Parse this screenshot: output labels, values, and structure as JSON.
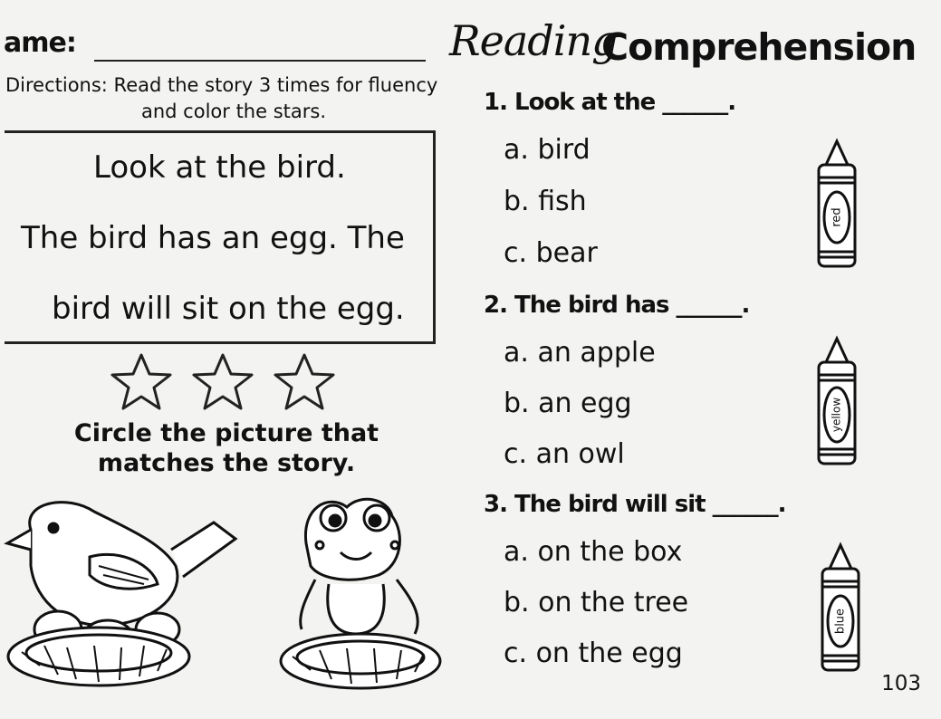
{
  "header": {
    "name_label": "ame:",
    "title_script": "Reading",
    "title_bold": "Comprehension"
  },
  "directions": {
    "line1": "Directions: Read the story 3 times for fluency",
    "line2": "and color the stars."
  },
  "story": {
    "lines": [
      "Look at the bird.",
      "The bird has an egg. The",
      "bird will sit on the egg."
    ]
  },
  "activity": {
    "instruction_line1": "Circle the picture that",
    "instruction_line2": "matches the story."
  },
  "questions": [
    {
      "prompt": "1. Look at the ______.",
      "choices": [
        "a. bird",
        "b. fish",
        "c. bear"
      ],
      "crayon_label": "red"
    },
    {
      "prompt": "2. The bird has ______.",
      "choices": [
        "a. an apple",
        "b. an egg",
        "c. an owl"
      ],
      "crayon_label": "yellow"
    },
    {
      "prompt": "3. The bird will sit ______.",
      "choices": [
        "a. on the box",
        "b. on the tree",
        "c. on the egg"
      ],
      "crayon_label": "blue"
    }
  ],
  "page_number": "103"
}
